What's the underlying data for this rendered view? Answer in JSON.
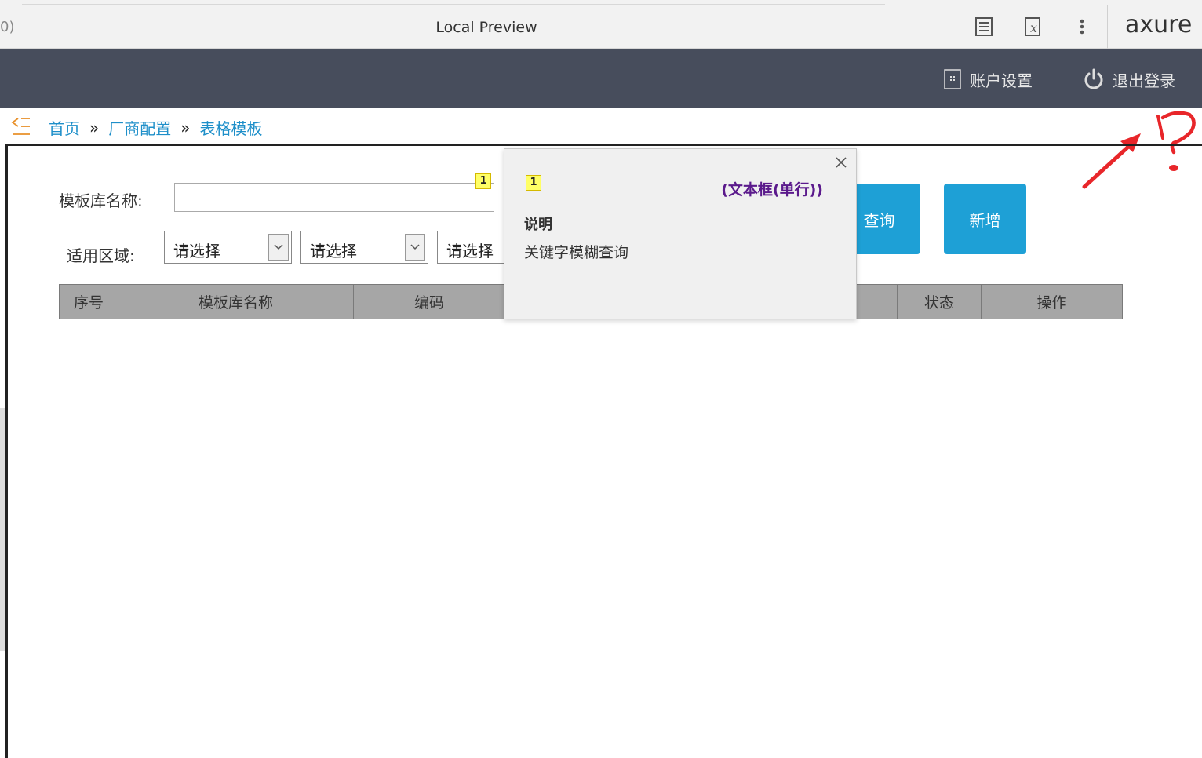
{
  "axure_bar": {
    "left_fragment": "0)",
    "title": "Local Preview",
    "logo": "axure",
    "icons": [
      "page-notes-icon",
      "variables-icon",
      "more-icon"
    ]
  },
  "header": {
    "account_settings": "账户设置",
    "logout": "退出登录"
  },
  "breadcrumb": {
    "items": [
      "首页",
      "厂商配置",
      "表格模板"
    ],
    "separator": "»"
  },
  "form": {
    "name_label": "模板库名称:",
    "name_value": "",
    "region_label": "适用区域:",
    "selects": [
      "请选择",
      "请选择",
      "请选择"
    ],
    "badge": "1"
  },
  "buttons": {
    "query": "查询",
    "add": "新增"
  },
  "table": {
    "columns": [
      "序号",
      "模板库名称",
      "编码",
      "",
      "状态",
      "操作"
    ]
  },
  "popup": {
    "badge": "1",
    "type": "(文本框(单行))",
    "heading": "说明",
    "description": "关键字模糊查询"
  },
  "colors": {
    "header_bg": "#474d5c",
    "button": "#1ea0d6",
    "link": "#1e8fc9",
    "annotation_red": "#e8262a"
  }
}
